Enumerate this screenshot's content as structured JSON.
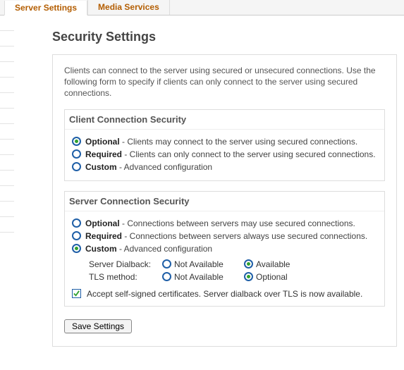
{
  "tabs": {
    "server_settings": "Server Settings",
    "media_services": "Media Services"
  },
  "page_title": "Security Settings",
  "intro": "Clients can connect to the server using secured or unsecured connections. Use the following form to specify if clients can only connect to the server using secured connections.",
  "client_group": {
    "header": "Client Connection Security",
    "options": {
      "optional": {
        "name": "Optional",
        "desc": " - Clients may connect to the server using secured connections.",
        "selected": true
      },
      "required": {
        "name": "Required",
        "desc": " - Clients can only connect to the server using secured connections.",
        "selected": false
      },
      "custom": {
        "name": "Custom",
        "desc": " - Advanced configuration",
        "selected": false
      }
    }
  },
  "server_group": {
    "header": "Server Connection Security",
    "options": {
      "optional": {
        "name": "Optional",
        "desc": " - Connections between servers may use secured connections.",
        "selected": false
      },
      "required": {
        "name": "Required",
        "desc": " - Connections between servers always use secured connections.",
        "selected": false
      },
      "custom": {
        "name": "Custom",
        "desc": " - Advanced configuration",
        "selected": true
      }
    },
    "dialback": {
      "label": "Server Dialback:",
      "opts": {
        "na": "Not Available",
        "avail": "Available"
      },
      "selected": "avail"
    },
    "tls": {
      "label": "TLS method:",
      "opts": {
        "na": "Not Available",
        "opt": "Optional"
      },
      "selected": "opt"
    },
    "accept_self_signed": {
      "label": "Accept self-signed certificates. Server dialback over TLS is now available.",
      "checked": true
    }
  },
  "save_button": "Save Settings"
}
